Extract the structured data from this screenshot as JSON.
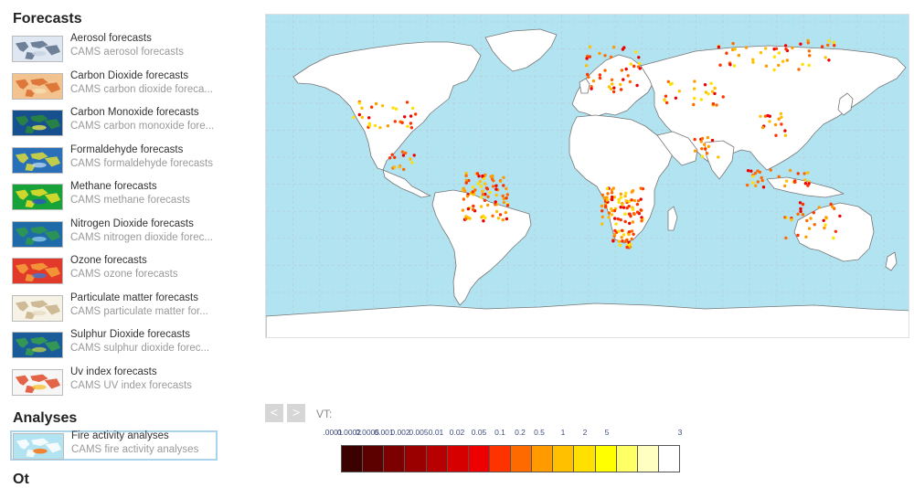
{
  "sidebar": {
    "forecasts_title": "Forecasts",
    "forecasts": [
      {
        "title": "Aerosol forecasts",
        "subtitle": "CAMS aerosol forecasts",
        "thumb": "aerosol"
      },
      {
        "title": "Carbon Dioxide forecasts",
        "subtitle": "CAMS carbon dioxide foreca...",
        "thumb": "co2"
      },
      {
        "title": "Carbon Monoxide forecasts",
        "subtitle": "CAMS carbon monoxide fore...",
        "thumb": "co"
      },
      {
        "title": "Formaldehyde forecasts",
        "subtitle": "CAMS formaldehyde forecasts",
        "thumb": "hcho"
      },
      {
        "title": "Methane forecasts",
        "subtitle": "CAMS methane forecasts",
        "thumb": "ch4"
      },
      {
        "title": "Nitrogen Dioxide forecasts",
        "subtitle": "CAMS nitrogen dioxide forec...",
        "thumb": "no2"
      },
      {
        "title": "Ozone forecasts",
        "subtitle": "CAMS ozone forecasts",
        "thumb": "o3"
      },
      {
        "title": "Particulate matter forecasts",
        "subtitle": "CAMS particulate matter for...",
        "thumb": "pm"
      },
      {
        "title": "Sulphur Dioxide forecasts",
        "subtitle": "CAMS sulphur dioxide forec...",
        "thumb": "so2"
      },
      {
        "title": "Uv index forecasts",
        "subtitle": "CAMS UV index forecasts",
        "thumb": "uv"
      }
    ],
    "analyses_title": "Analyses",
    "analyses": [
      {
        "title": "Fire activity analyses",
        "subtitle": "CAMS fire activity analyses",
        "thumb": "fire",
        "selected": true
      }
    ],
    "next_section_title": "Ot"
  },
  "map": {
    "name": "fire activity world map",
    "land_color": "#ffffff",
    "ocean_color": "#b2e3f0",
    "border_color": "#777777"
  },
  "controls": {
    "prev_icon": "chevron-left-icon",
    "next_icon": "chevron-right-icon",
    "prev_glyph": "<",
    "next_glyph": ">",
    "vt_label": "VT:"
  },
  "legend": {
    "labels": [
      ".0001",
      "0.0002",
      "0.0005",
      "0.001",
      "0.002",
      "0.005",
      "0.01",
      "0.02",
      "0.05",
      "0.1",
      "0.2",
      "0.5",
      "1",
      "2",
      "5",
      "3"
    ],
    "colors": [
      "#3b0000",
      "#5c0000",
      "#7c0000",
      "#9a0000",
      "#b80000",
      "#d60000",
      "#ee0000",
      "#ff3300",
      "#ff6a00",
      "#ff9a00",
      "#ffc000",
      "#ffe000",
      "#ffff00",
      "#ffff66",
      "#ffffc2",
      "#ffffff"
    ]
  }
}
